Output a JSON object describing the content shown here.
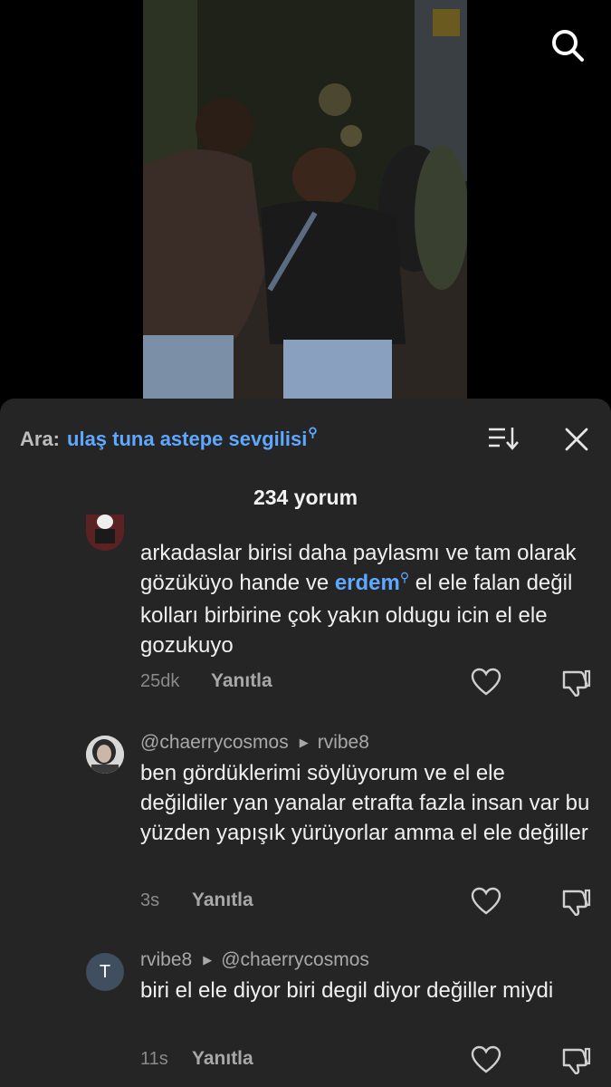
{
  "search": {
    "prefix": "Ara:",
    "query": "ulaş tuna astepe sevgilisi"
  },
  "comments_header": {
    "count_label": "234 yorum"
  },
  "comments": [
    {
      "text_before": "arkadaslar birisi daha paylasmı ve tam olarak gözüküyo hande ve ",
      "mention": "erdem",
      "text_after": " el ele falan değil kolları birbirine çok yakın oldugu icin el ele gozukuyo",
      "time": "25dk",
      "reply_label": "Yanıtla"
    },
    {
      "author": "@chaerrycosmos",
      "reply_to": "rvibe8",
      "text": "ben gördüklerimi söylüyorum ve el ele değildiler yan yanalar etrafta fazla insan var bu yüzden yapışık yürüyorlar amma el ele değiller",
      "time": "3s",
      "reply_label": "Yanıtla"
    },
    {
      "author": "rvibe8",
      "avatar_initial": "T",
      "reply_to": "@chaerrycosmos",
      "text": "biri el ele diyor biri degil diyor değiller miydi",
      "time": "11s",
      "reply_label": "Yanıtla"
    }
  ],
  "colors": {
    "sheet_bg": "#252525",
    "accent_blue": "#5ea8ff",
    "muted_text": "#a8a8a8"
  },
  "icons": [
    "search-icon",
    "sort-icon",
    "close-icon",
    "heart-icon",
    "dislike-icon"
  ]
}
